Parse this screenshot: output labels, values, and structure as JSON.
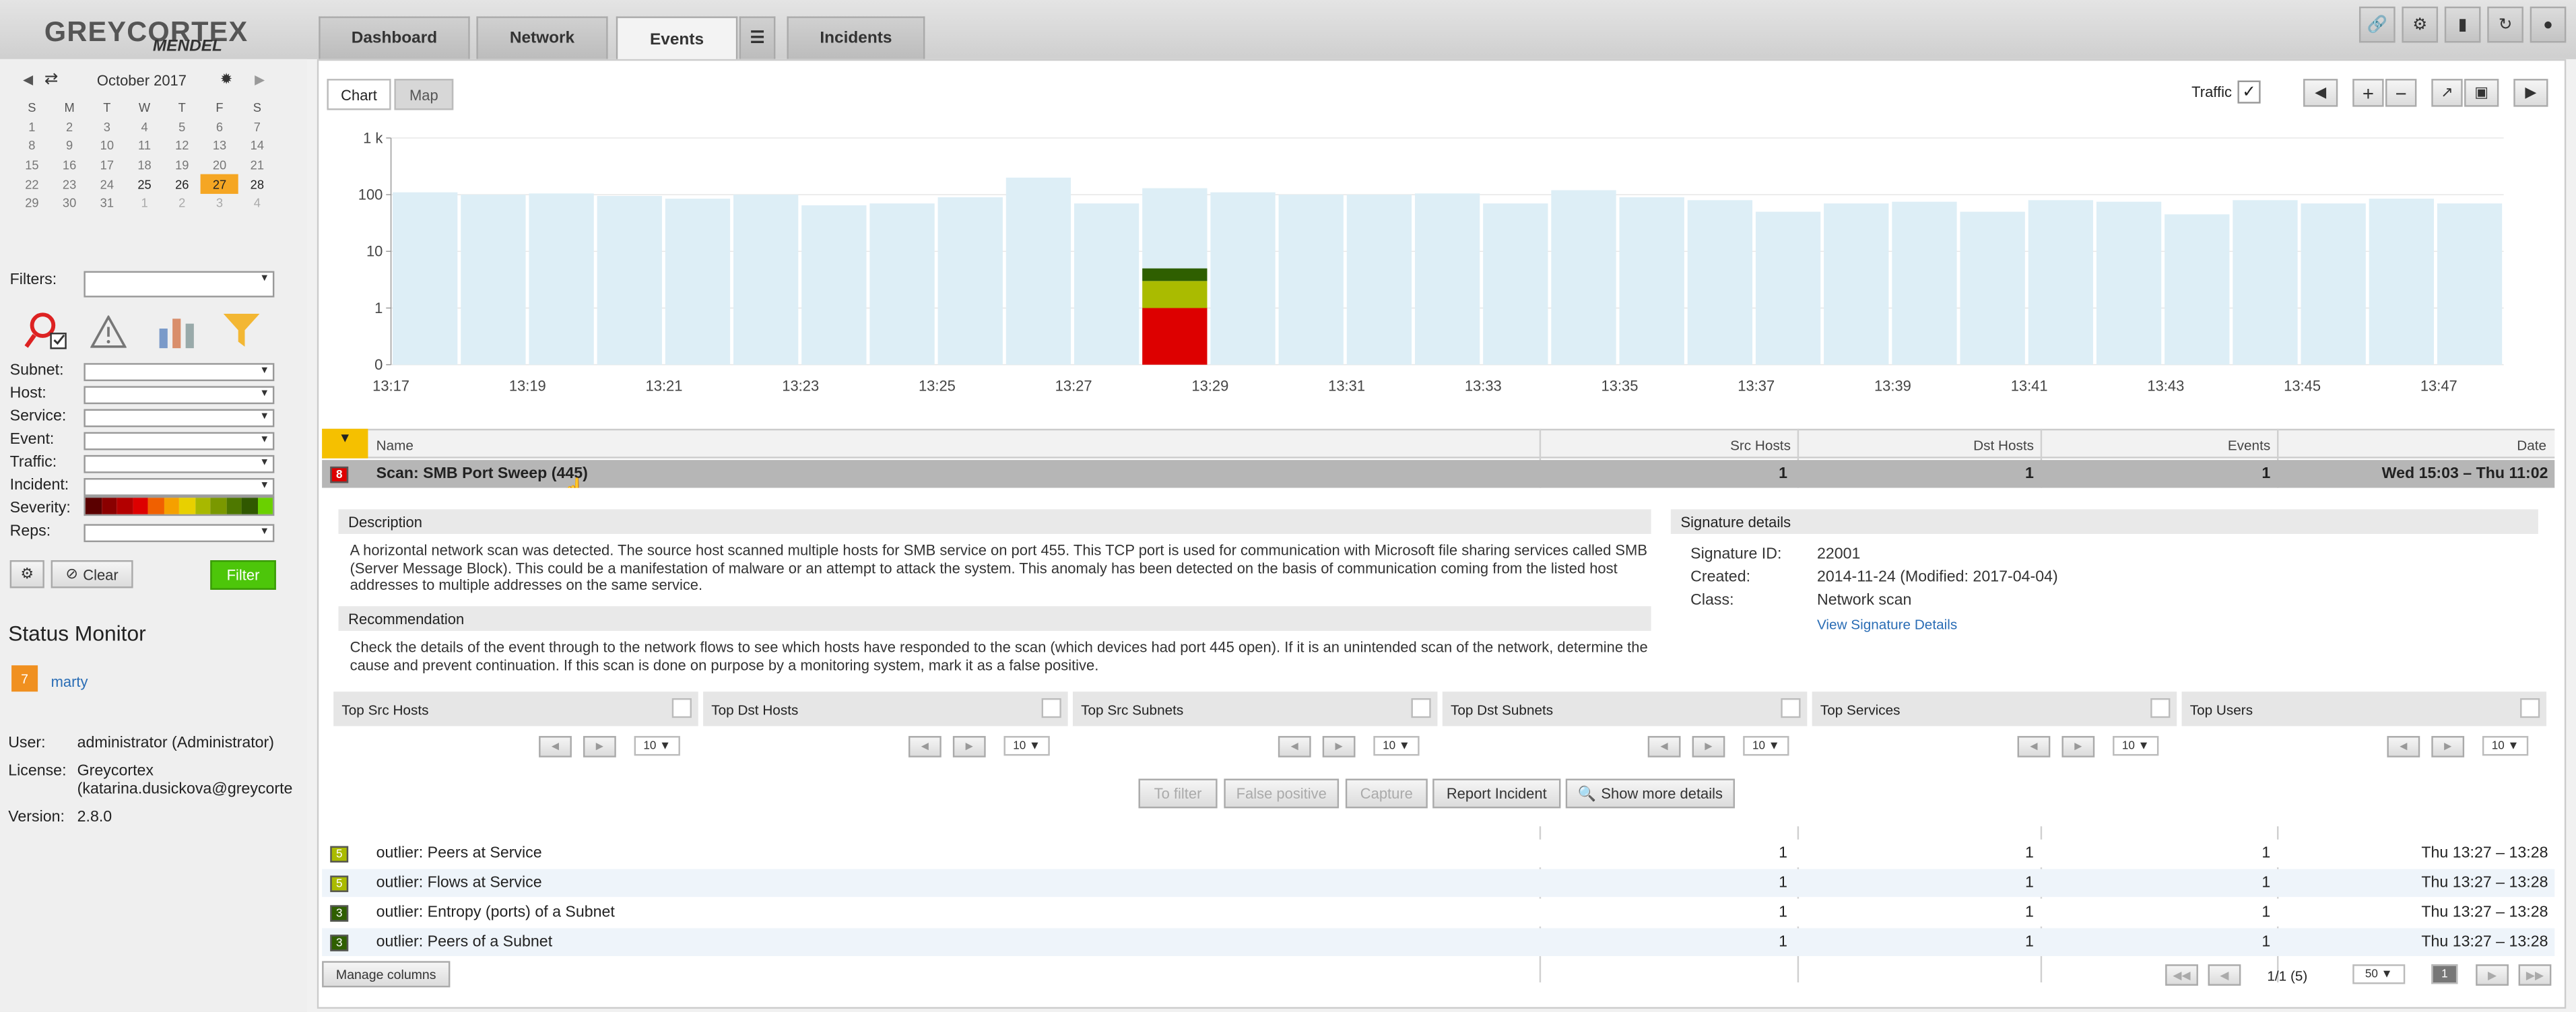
{
  "app": {
    "logo_main": "GREYCORTEX",
    "logo_sub": "MENDEL"
  },
  "tabs": [
    {
      "label": "Dashboard"
    },
    {
      "label": "Network"
    },
    {
      "label": "Events",
      "active": true
    },
    {
      "label": "Incidents"
    }
  ],
  "calendar": {
    "month": "October 2017",
    "weekdays": [
      "S",
      "M",
      "T",
      "W",
      "T",
      "F",
      "S"
    ],
    "weeks": [
      [
        "1",
        "2",
        "3",
        "4",
        "5",
        "6",
        "7"
      ],
      [
        "8",
        "9",
        "10",
        "11",
        "12",
        "13",
        "14"
      ],
      [
        "15",
        "16",
        "17",
        "18",
        "19",
        "20",
        "21"
      ],
      [
        "22",
        "23",
        "24",
        "25",
        "26",
        "27",
        "28"
      ],
      [
        "29",
        "30",
        "31",
        "1",
        "2",
        "3",
        "4"
      ]
    ],
    "today": "27"
  },
  "filters": {
    "title": "Filters:",
    "fields": [
      "Subnet:",
      "Host:",
      "Service:",
      "Event:",
      "Traffic:",
      "Incident:",
      "Severity:",
      "Reps:"
    ],
    "clear": "Clear",
    "filter": "Filter"
  },
  "status": {
    "title": "Status Monitor",
    "user_badge": "7",
    "user_link": "marty",
    "user_label": "User:",
    "user_value": "administrator (Administrator)",
    "license_label": "License:",
    "license_value1": "Greycortex",
    "license_value2": "(katarina.dusickova@greycorte",
    "version_label": "Version:",
    "version_value": "2.8.0"
  },
  "chart_tabs": {
    "chart": "Chart",
    "map": "Map",
    "traffic": "Traffic"
  },
  "colors": {
    "bar": "#ddeef6",
    "sev_red": "#dd0000",
    "sev_yellow": "#aabb00",
    "sev_green": "#2f5f00",
    "filter_green": "#4dc60a"
  },
  "chart_data": {
    "type": "bar",
    "scale": "log",
    "ylim": [
      0,
      1000
    ],
    "y_ticks": [
      "1 k",
      "100",
      "10",
      "1",
      "0"
    ],
    "x_ticks": [
      "13:17",
      "13:19",
      "13:21",
      "13:23",
      "13:25",
      "13:27",
      "13:29",
      "13:31",
      "13:33",
      "13:35",
      "13:37",
      "13:39",
      "13:41",
      "13:43",
      "13:45",
      "13:47"
    ],
    "values": [
      110,
      100,
      105,
      95,
      85,
      100,
      65,
      70,
      90,
      200,
      70,
      130,
      110,
      100,
      100,
      105,
      70,
      120,
      90,
      80,
      50,
      70,
      75,
      50,
      80,
      75,
      45,
      80,
      70,
      85,
      70
    ],
    "stacked_bar": {
      "index": 11,
      "red": 1,
      "yellow": 3,
      "green": 5
    }
  },
  "table": {
    "headers": {
      "name": "Name",
      "src": "Src Hosts",
      "dst": "Dst Hosts",
      "events": "Events",
      "date": "Date"
    },
    "selected": {
      "severity": "8",
      "name": "Scan: SMB Port Sweep (445)",
      "src": "1",
      "dst": "1",
      "events": "1",
      "date": "Wed 15:03 – Thu 11:02"
    },
    "rows": [
      {
        "severity": "5",
        "name": "outlier: Peers at Service",
        "src": "1",
        "dst": "1",
        "events": "1",
        "date": "Thu 13:27 – 13:28"
      },
      {
        "severity": "5",
        "name": "outlier: Flows at Service",
        "src": "1",
        "dst": "1",
        "events": "1",
        "date": "Thu 13:27 – 13:28"
      },
      {
        "severity": "3",
        "name": "outlier: Entropy (ports) of a Subnet",
        "src": "1",
        "dst": "1",
        "events": "1",
        "date": "Thu 13:27 – 13:28"
      },
      {
        "severity": "3",
        "name": "outlier: Peers of a Subnet",
        "src": "1",
        "dst": "1",
        "events": "1",
        "date": "Thu 13:27 – 13:28"
      }
    ]
  },
  "detail": {
    "desc_title": "Description",
    "desc": "A horizontal network scan was detected. The source host scanned multiple hosts for SMB service on port 455. This TCP port is used for communication with Microsoft file sharing services called SMB (Server Message Block). This could be a manifestation of malware or an attempt to attack the system. This anomaly has been detected on the basis of communication coming from the listed host addresses to multiple addresses on the same service.",
    "rec_title": "Recommendation",
    "rec": "Check the details of the event through to the network flows to see which hosts have responded to the scan (which devices had port 445 open). If it is an unintended scan of the network, determine the cause and prevent continuation. If this scan is done on purpose by a monitoring system, mark it as a false positive.",
    "sig_title": "Signature details",
    "sig_id_label": "Signature ID:",
    "sig_id": "22001",
    "created_label": "Created:",
    "created": "2014-11-24 (Modified: 2017-04-04)",
    "class_label": "Class:",
    "class": "Network scan",
    "view_link": "View Signature Details",
    "tops": [
      "Top Src Hosts",
      "Top Dst Hosts",
      "Top Src Subnets",
      "Top Dst Subnets",
      "Top Services",
      "Top Users"
    ],
    "page_size": "10",
    "actions": {
      "to_filter": "To filter",
      "false_positive": "False positive",
      "capture": "Capture",
      "report": "Report Incident",
      "more": "Show more details"
    }
  },
  "footer": {
    "manage": "Manage columns",
    "pages": "1/1 (5)",
    "page_size": "50",
    "page": "1"
  }
}
